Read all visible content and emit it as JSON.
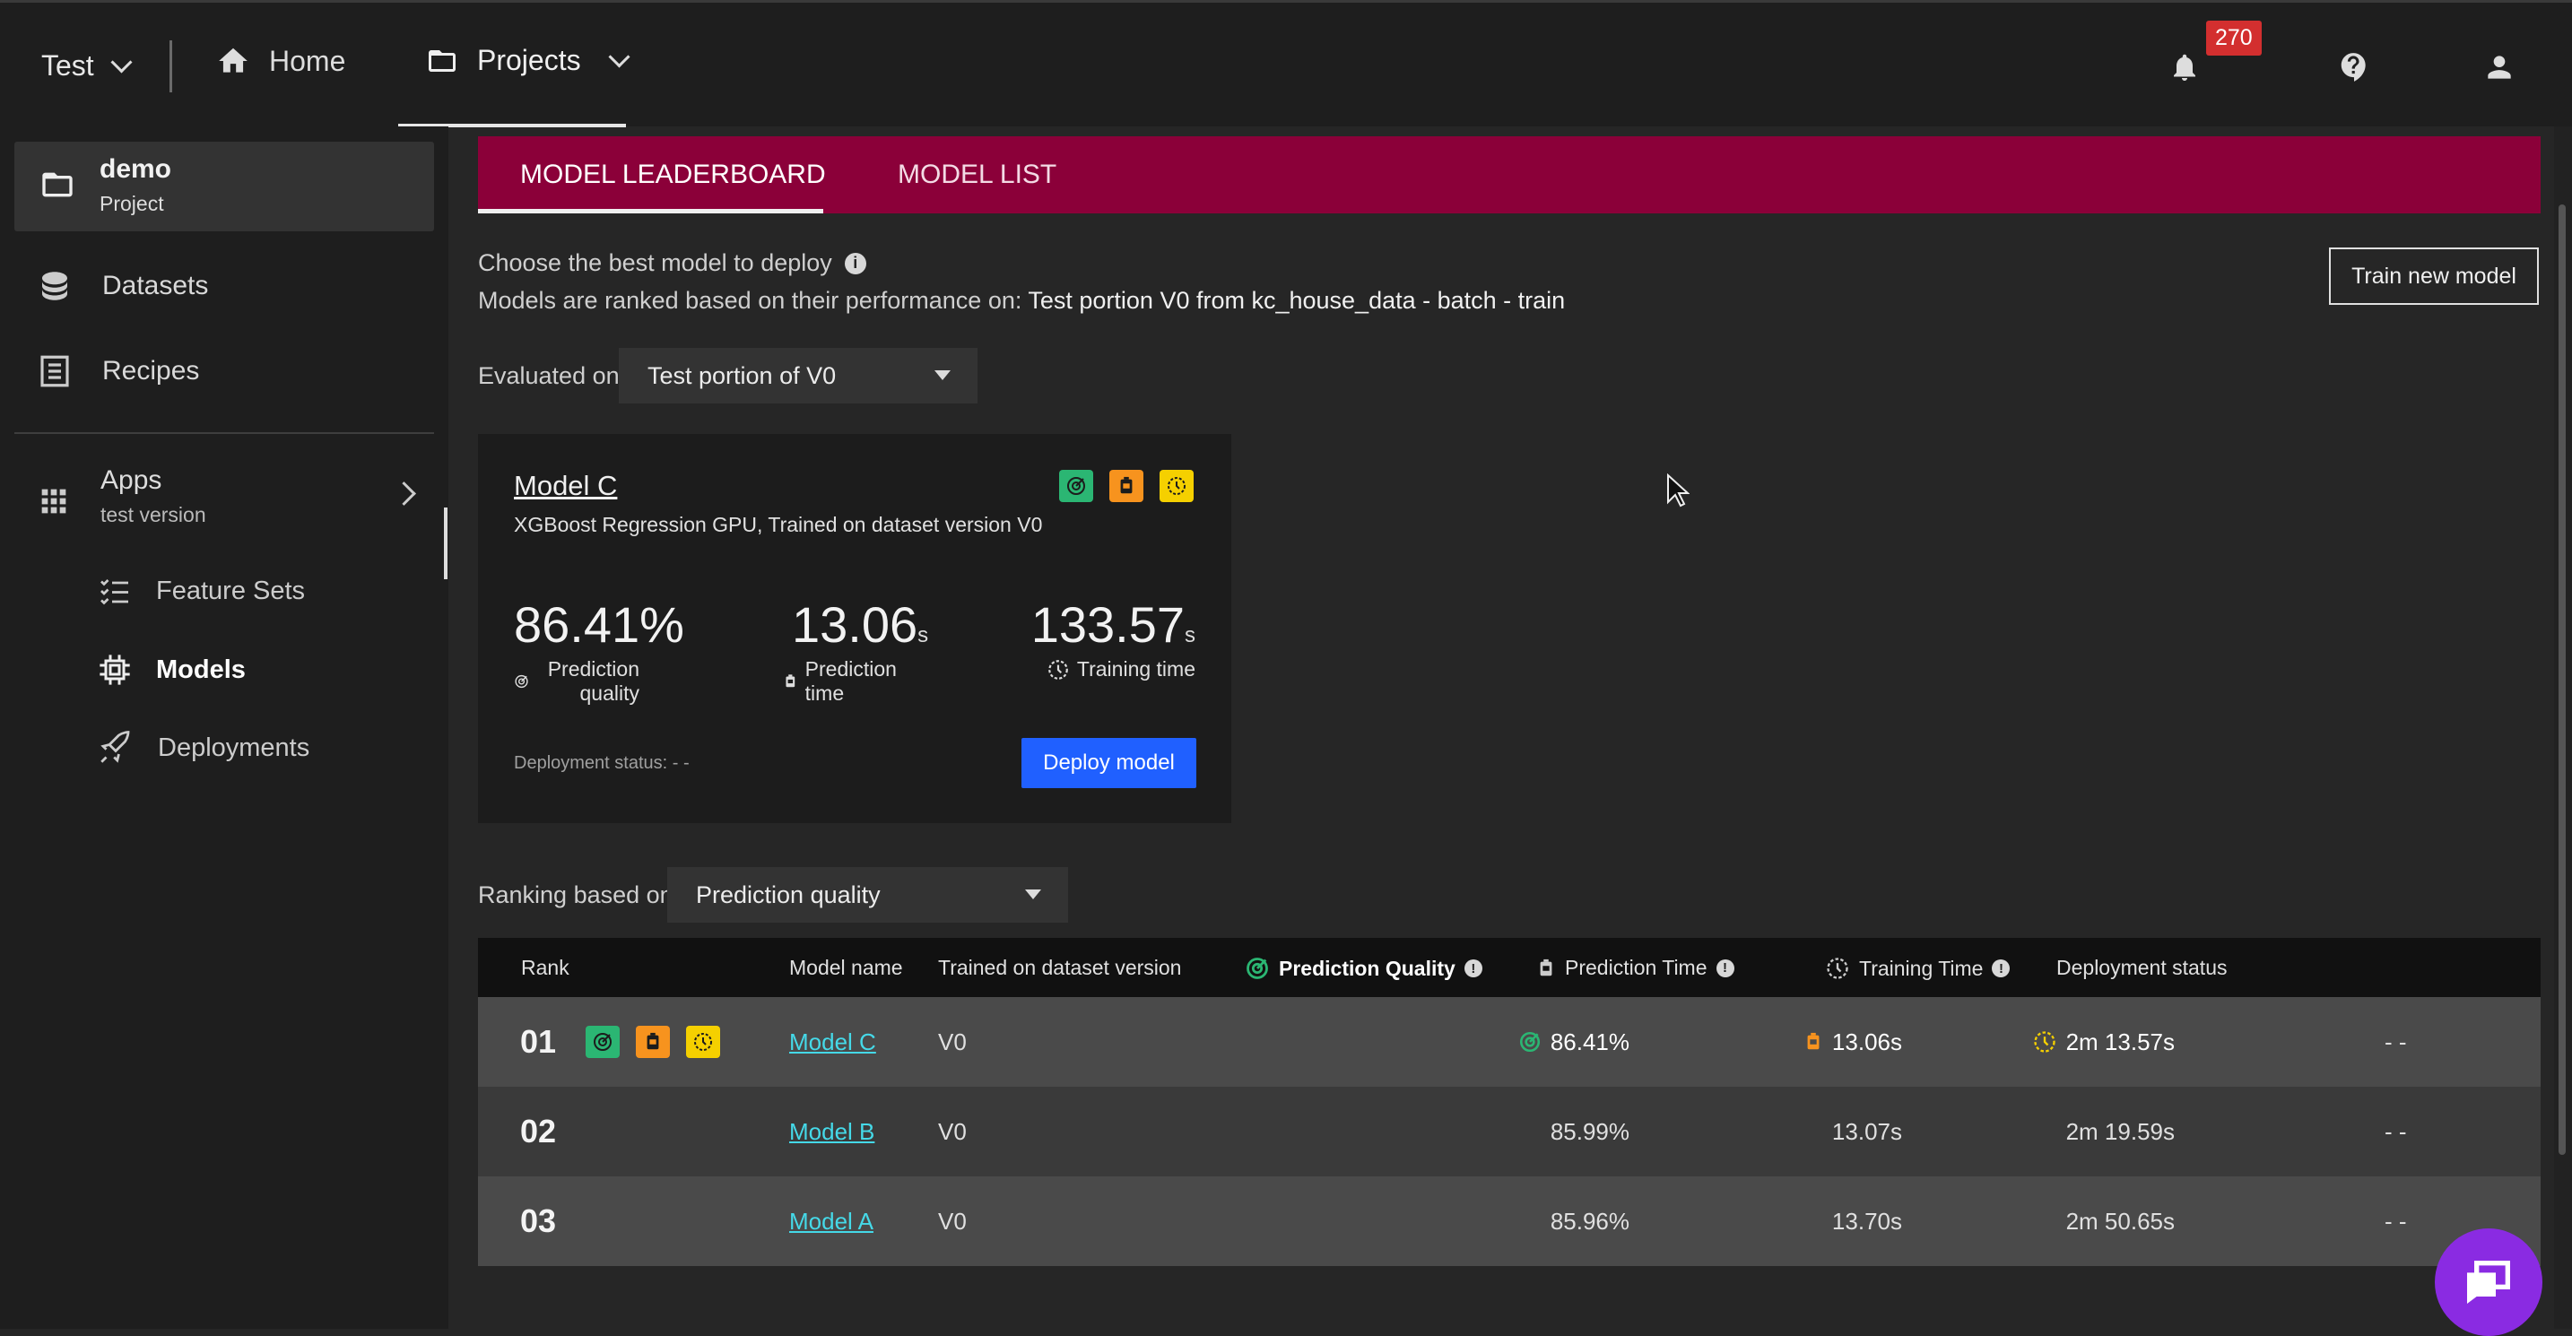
{
  "topbar": {
    "workspace": "Test",
    "home_label": "Home",
    "projects_label": "Projects",
    "notification_count": "270"
  },
  "sidebar": {
    "project_name": "demo",
    "project_type": "Project",
    "items": [
      {
        "label": "Datasets"
      },
      {
        "label": "Recipes"
      }
    ],
    "apps": {
      "label": "Apps",
      "sub": "test version"
    },
    "sub_items": [
      {
        "label": "Feature Sets"
      },
      {
        "label": "Models"
      },
      {
        "label": "Deployments"
      }
    ]
  },
  "tabs": [
    "MODEL LEADERBOARD",
    "MODEL LIST"
  ],
  "intro": {
    "line1": "Choose the best model to deploy",
    "line2_prefix": "Models are ranked based on their performance on: ",
    "line2_value": "Test portion V0 from kc_house_data - batch - train"
  },
  "train_button": "Train new model",
  "evaluated": {
    "label": "Evaluated on",
    "value": "Test portion of V0"
  },
  "best_model": {
    "name": "Model C",
    "description": "XGBoost Regression GPU, Trained on dataset version V0",
    "quality": "86.41%",
    "quality_label": "Prediction quality",
    "prediction_time": "13.06",
    "prediction_time_unit": "s",
    "prediction_time_label": "Prediction time",
    "training_time": "133.57",
    "training_time_unit": "s",
    "training_time_label": "Training time",
    "deployment_status": "Deployment status: - -",
    "deploy_button": "Deploy model"
  },
  "ranking": {
    "label": "Ranking based on",
    "value": "Prediction quality"
  },
  "table": {
    "headers": {
      "rank": "Rank",
      "model_name": "Model name",
      "trained_on": "Trained on dataset version",
      "quality": "Prediction Quality",
      "prediction_time": "Prediction Time",
      "training_time": "Training Time",
      "deployment_status": "Deployment status"
    },
    "rows": [
      {
        "rank": "01",
        "model": "Model C",
        "version": "V0",
        "quality": "86.41%",
        "prediction_time": "13.06s",
        "training_time": "2m 13.57s",
        "status": "- -"
      },
      {
        "rank": "02",
        "model": "Model B",
        "version": "V0",
        "quality": "85.99%",
        "prediction_time": "13.07s",
        "training_time": "2m 19.59s",
        "status": "- -"
      },
      {
        "rank": "03",
        "model": "Model A",
        "version": "V0",
        "quality": "85.96%",
        "prediction_time": "13.70s",
        "training_time": "2m 50.65s",
        "status": "- -"
      }
    ]
  },
  "colors": {
    "accent_tab_bar": "#8b0039",
    "deploy_button": "#2060ff",
    "quality_badge": "#2bb673",
    "prediction_badge": "#f7931e",
    "training_badge": "#f5d000",
    "link": "#45d9e8",
    "notification_badge": "#d32f2f",
    "chat_button": "#8a2be2"
  }
}
